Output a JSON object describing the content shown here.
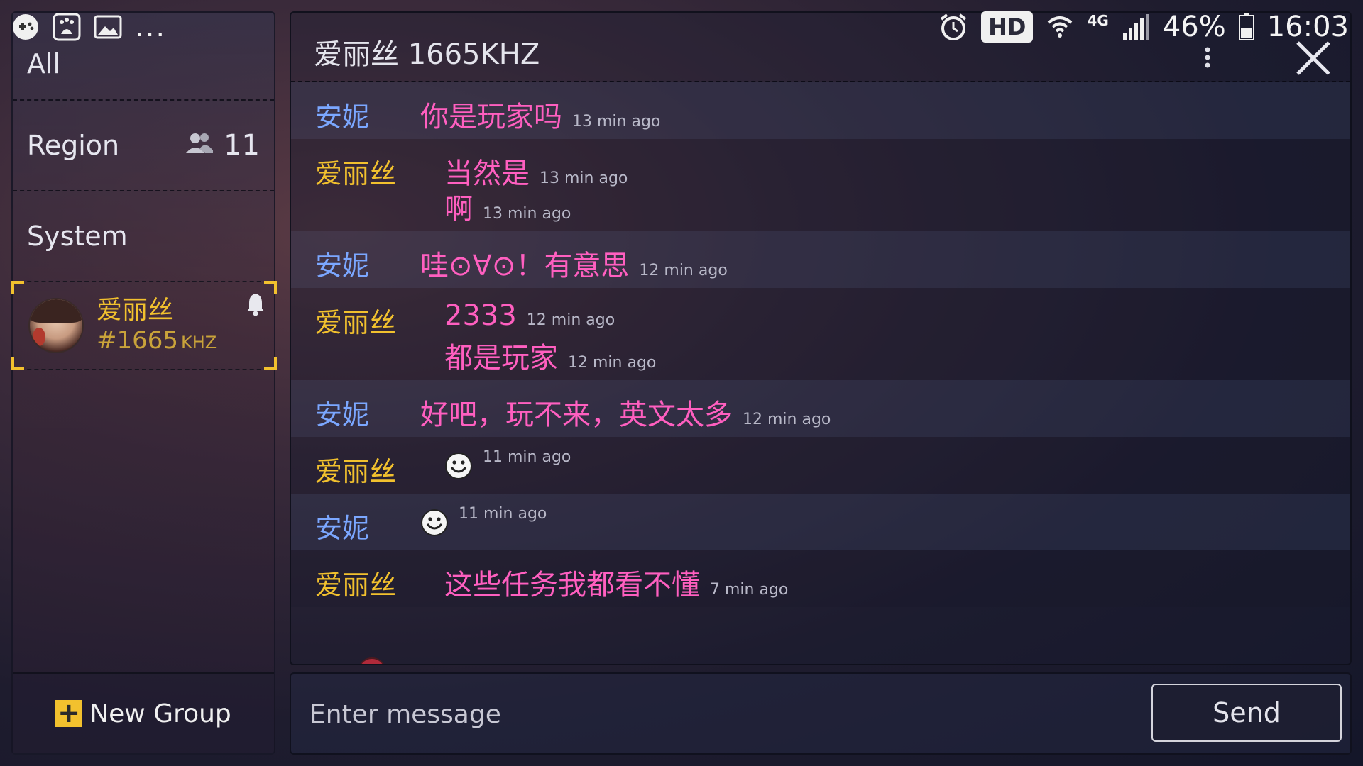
{
  "status_bar": {
    "left_icons": [
      "game-controller-icon",
      "baidu-paw-icon",
      "gallery-icon"
    ],
    "more": "...",
    "hd": "HD",
    "network": "4G",
    "battery_percent": "46%",
    "time": "16:03",
    "right_icons": [
      "alarm-icon",
      "wifi-icon",
      "signal-icon",
      "battery-icon"
    ]
  },
  "sidebar": {
    "all_label": "All",
    "region_label": "Region",
    "region_count": "11",
    "system_label": "System",
    "group": {
      "name": "爱丽丝",
      "code": "#1665",
      "unit": "KHZ"
    },
    "new_group_plus": "+",
    "new_group_label": "New Group"
  },
  "chat": {
    "title": "爱丽丝 1665KHZ",
    "messages": [
      {
        "sender": "安妮",
        "sender_color": "#7ba7ff",
        "lines": [
          {
            "text": "你是玩家吗",
            "time": "13 min ago"
          }
        ]
      },
      {
        "sender": "爱丽丝",
        "sender_color": "#f2c12e",
        "lines": [
          {
            "text": "当然是",
            "time": "13 min ago"
          },
          {
            "text": "啊",
            "time": "13 min ago"
          }
        ]
      },
      {
        "sender": "安妮",
        "sender_color": "#7ba7ff",
        "lines": [
          {
            "text": "哇⊙∀⊙！有意思",
            "time": "12 min ago"
          }
        ]
      },
      {
        "sender": "爱丽丝",
        "sender_color": "#f2c12e",
        "lines": [
          {
            "text": "2333",
            "time": "12 min ago"
          },
          {
            "text": "都是玩家",
            "time": "12 min ago"
          }
        ]
      },
      {
        "sender": "安妮",
        "sender_color": "#7ba7ff",
        "lines": [
          {
            "text": "好吧，玩不来，英文太多",
            "time": "12 min ago"
          }
        ]
      },
      {
        "sender": "爱丽丝",
        "sender_color": "#f2c12e",
        "lines": [
          {
            "emoji": "smiley-icon",
            "time": "11 min ago"
          }
        ]
      },
      {
        "sender": "安妮",
        "sender_color": "#7ba7ff",
        "lines": [
          {
            "emoji": "smiley-icon",
            "time": "11 min ago"
          }
        ]
      },
      {
        "sender": "爱丽丝",
        "sender_color": "#f2c12e",
        "lines": [
          {
            "text": "这些任务我都看不懂",
            "time": "7 min ago"
          }
        ]
      }
    ]
  },
  "input": {
    "placeholder": "Enter message",
    "value": "",
    "send_label": "Send"
  },
  "colors": {
    "accent_yellow": "#f2c12e",
    "message_pink": "#ff5fc0",
    "annie_blue": "#7ba7ff"
  }
}
